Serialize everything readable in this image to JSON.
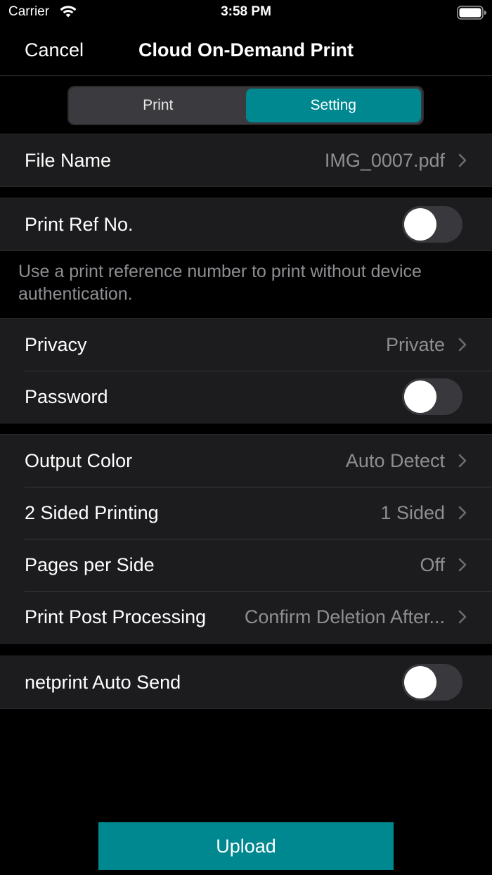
{
  "status": {
    "carrier": "Carrier",
    "time": "3:58 PM"
  },
  "nav": {
    "cancel": "Cancel",
    "title": "Cloud On-Demand Print"
  },
  "segments": {
    "print": "Print",
    "setting": "Setting",
    "selected": "Setting"
  },
  "file": {
    "label": "File Name",
    "value": "IMG_0007.pdf"
  },
  "ref": {
    "label": "Print Ref No.",
    "enabled": false,
    "footnote": "Use a print reference number to print without device authentication."
  },
  "security": {
    "privacy_label": "Privacy",
    "privacy_value": "Private",
    "password_label": "Password",
    "password_enabled": false
  },
  "options": {
    "output_color_label": "Output Color",
    "output_color_value": "Auto Detect",
    "sided_label": "2 Sided Printing",
    "sided_value": "1 Sided",
    "pages_label": "Pages per Side",
    "pages_value": "Off",
    "post_label": "Print Post Processing",
    "post_value": "Confirm Deletion After..."
  },
  "netprint": {
    "label": "netprint Auto Send",
    "enabled": false
  },
  "upload_label": "Upload",
  "colors": {
    "accent": "#008891",
    "background": "#000000",
    "cell": "#1c1c1e",
    "secondary_text": "#8e8e93"
  }
}
